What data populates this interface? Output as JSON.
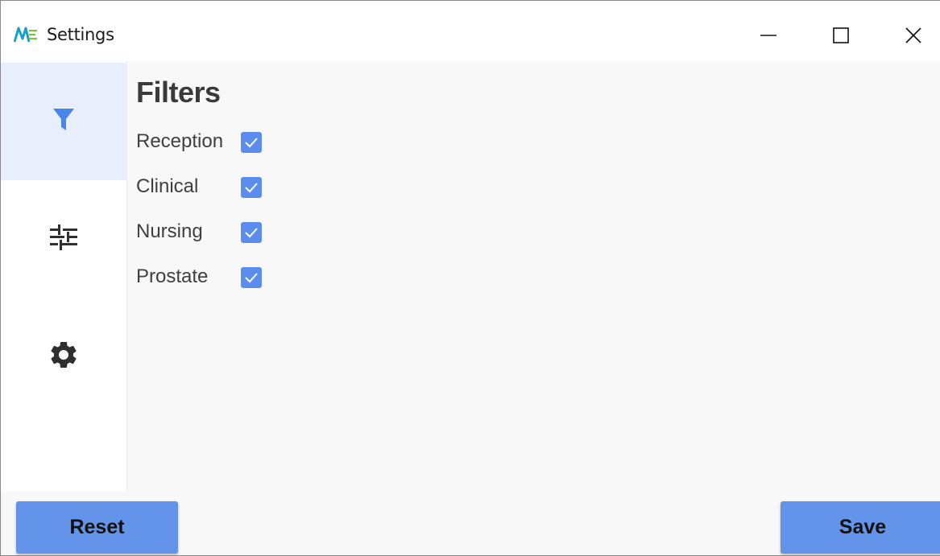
{
  "window": {
    "title": "Settings",
    "app_icon": "app-logo-icon"
  },
  "titlebar_controls": {
    "minimize_icon": "minimize-icon",
    "maximize_icon": "maximize-icon",
    "close_icon": "close-icon"
  },
  "sidebar": {
    "items": [
      {
        "id": "filters",
        "icon": "filter-icon",
        "active": true
      },
      {
        "id": "tuning",
        "icon": "sliders-icon",
        "active": false
      },
      {
        "id": "settings",
        "icon": "gear-icon",
        "active": false
      }
    ]
  },
  "main": {
    "title": "Filters",
    "filters": [
      {
        "label": "Reception",
        "checked": true
      },
      {
        "label": "Clinical",
        "checked": true
      },
      {
        "label": "Nursing",
        "checked": true
      },
      {
        "label": "Prostate",
        "checked": true
      }
    ]
  },
  "footer": {
    "reset_label": "Reset",
    "save_label": "Save"
  },
  "colors": {
    "accent": "#5b8def",
    "button": "#6493ea",
    "sidebar_active": "#e8eefb",
    "content_bg": "#f8f8f8"
  }
}
